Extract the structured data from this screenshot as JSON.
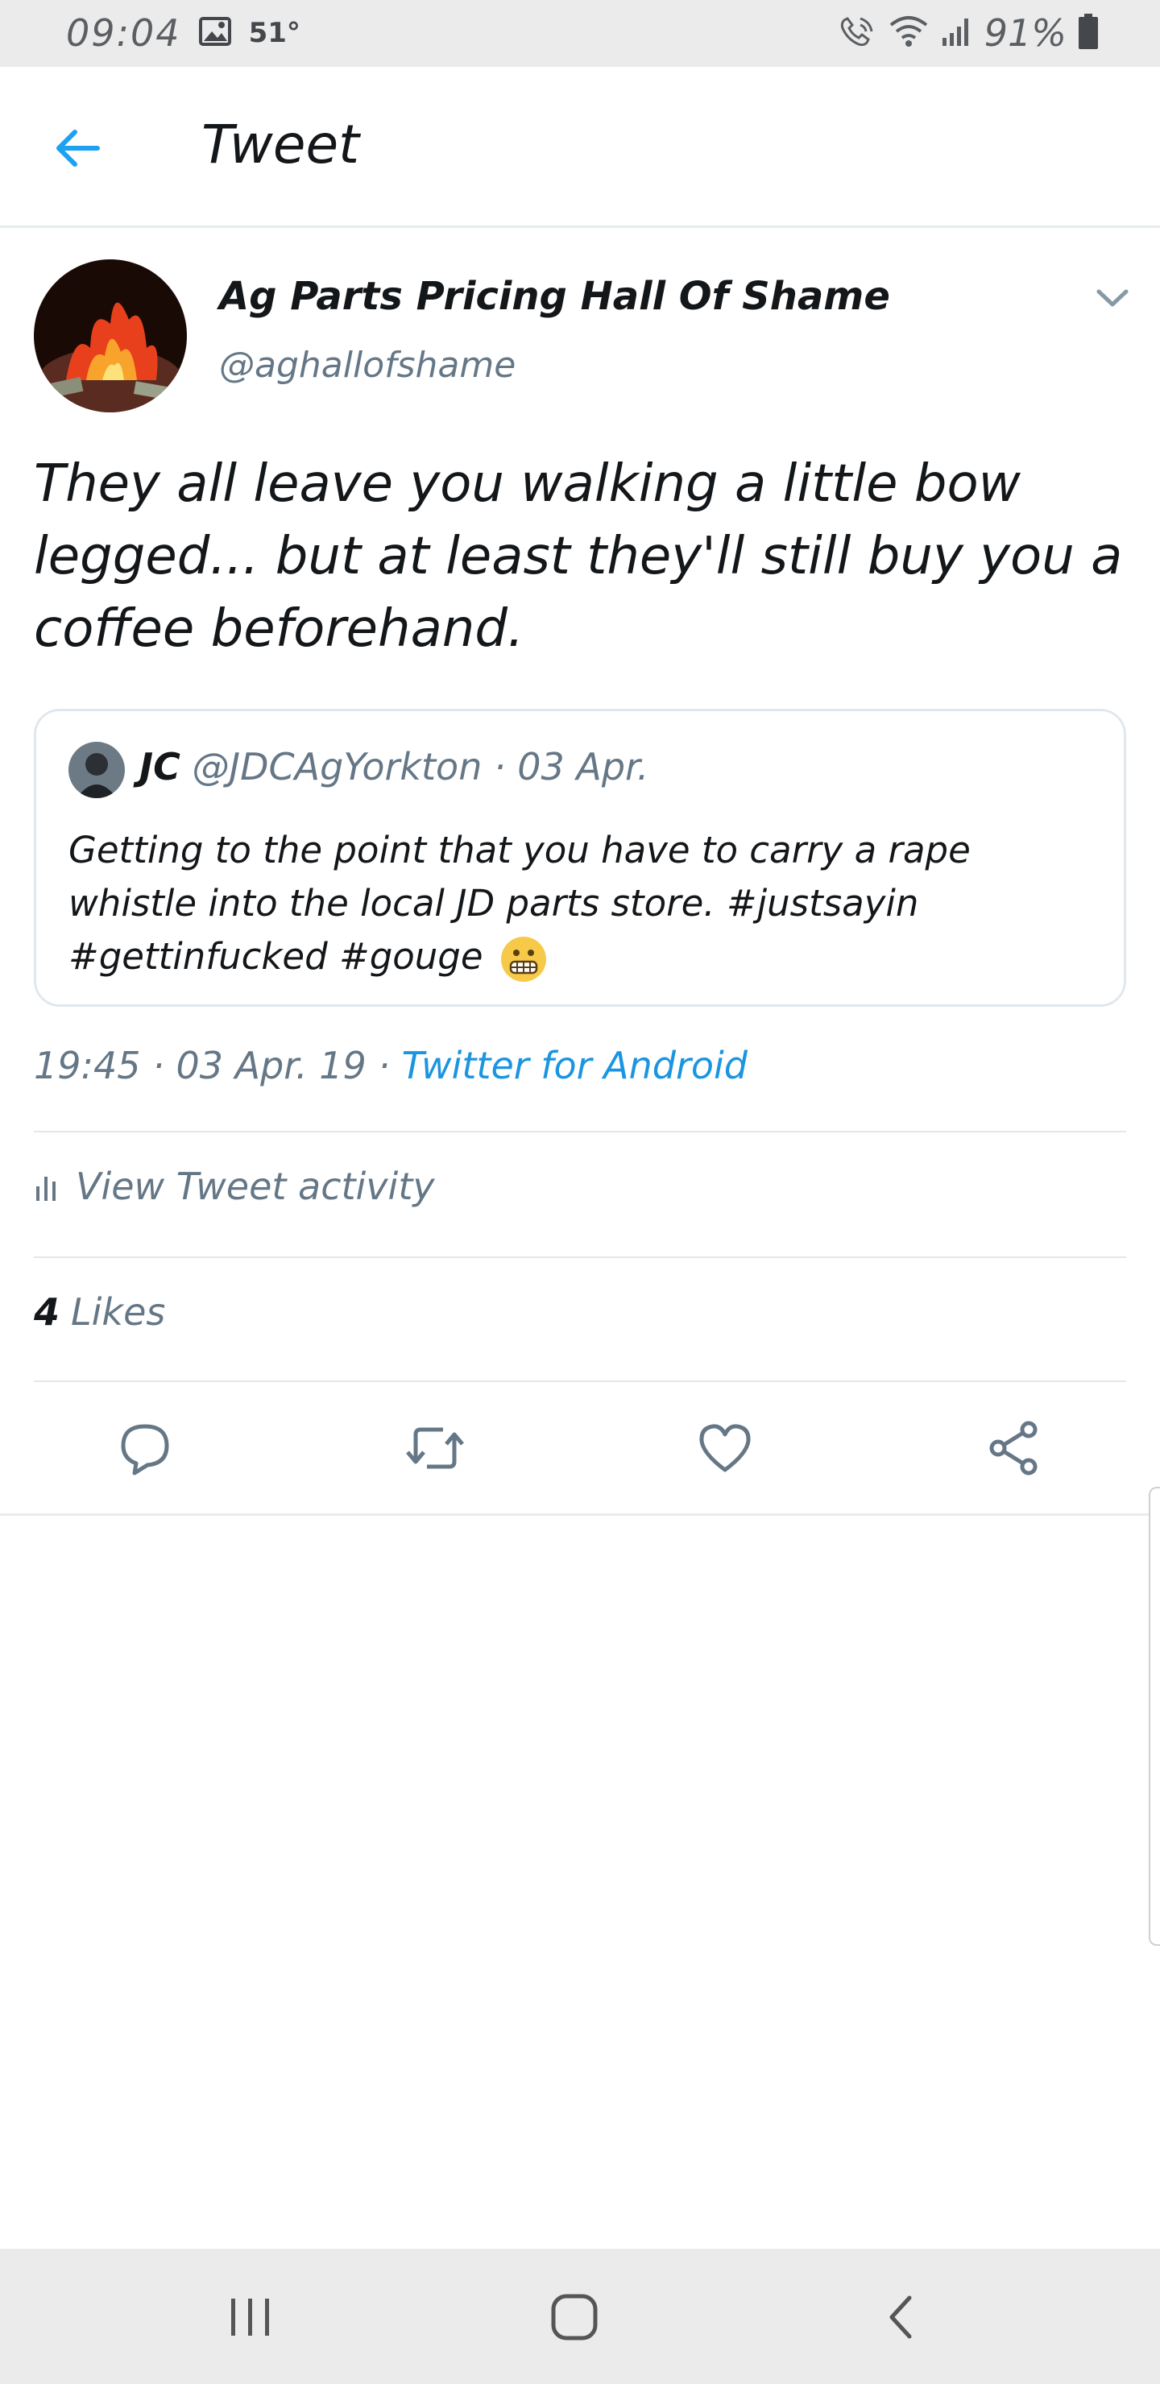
{
  "status_bar": {
    "time": "09:04",
    "temperature": "51°",
    "battery_percent": "91%",
    "icons": [
      "image-icon",
      "call-icon",
      "wifi-icon",
      "signal-icon",
      "battery-icon"
    ]
  },
  "header": {
    "title": "Tweet",
    "back_icon": "arrow-left-icon"
  },
  "tweet": {
    "author_name": "Ag Parts Pricing Hall Of Shame",
    "author_handle": "@aghallofshame",
    "text": "They all leave you walking a little bow legged...  but at least they'll still buy you a coffee beforehand.",
    "quoted": {
      "name": "JC",
      "handle": "@JDCAgYorkton",
      "separator": "·",
      "date": "03 Apr.",
      "text": "Getting to the point that you have to carry a rape whistle into the local JD parts store. #justsayin #gettinfucked #gouge",
      "emoji": "grimacing-face-emoji"
    },
    "time": "19:45",
    "date": "03 Apr. 19",
    "dot": "·",
    "source": "Twitter for Android",
    "activity_label": "View Tweet activity",
    "likes_count": "4",
    "likes_label": "Likes"
  },
  "actions": [
    "reply-icon",
    "retweet-icon",
    "like-icon",
    "share-icon"
  ],
  "colors": {
    "accent": "#1b95e0",
    "secondary_text": "#657786",
    "divider": "#e1e8ed"
  },
  "nav_bar": [
    "recent-apps-icon",
    "home-icon",
    "back-icon"
  ]
}
